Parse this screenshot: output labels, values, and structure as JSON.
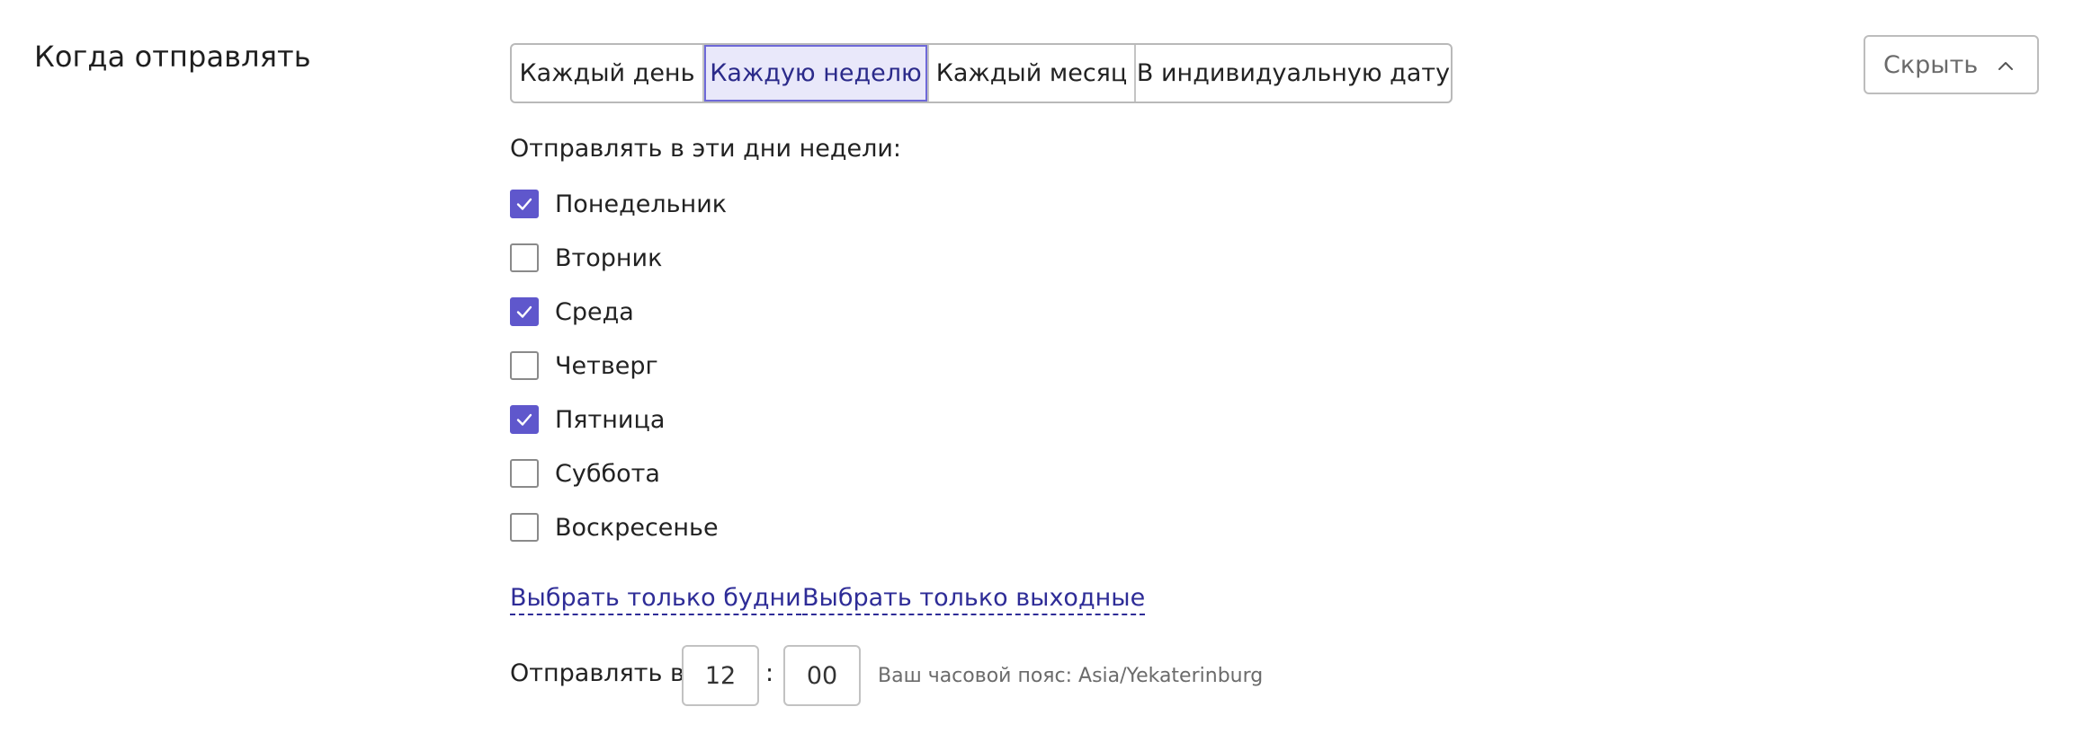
{
  "section": {
    "title": "Когда отправлять"
  },
  "frequency": {
    "options": [
      "Каждый день",
      "Каждую неделю",
      "Каждый месяц",
      "В индивидуальную дату"
    ],
    "selected_index": 1
  },
  "hide_button": {
    "label": "Скрыть",
    "icon": "chevron-up-icon"
  },
  "days": {
    "label": "Отправлять в эти дни недели:",
    "items": [
      {
        "label": "Понедельник",
        "checked": true
      },
      {
        "label": "Вторник",
        "checked": false
      },
      {
        "label": "Среда",
        "checked": true
      },
      {
        "label": "Четверг",
        "checked": false
      },
      {
        "label": "Пятница",
        "checked": true
      },
      {
        "label": "Суббота",
        "checked": false
      },
      {
        "label": "Воскресенье",
        "checked": false
      }
    ]
  },
  "links": {
    "weekdays": "Выбрать только будни",
    "weekends": "Выбрать только выходные"
  },
  "time": {
    "label": "Отправлять в",
    "hours": "12",
    "separator": ":",
    "minutes": "00",
    "timezone_note": "Ваш часовой пояс: Asia/Yekaterinburg"
  },
  "colors": {
    "accent": "#5f57cc",
    "link": "#2e2c97",
    "selected_bg": "#e9e8fa"
  }
}
